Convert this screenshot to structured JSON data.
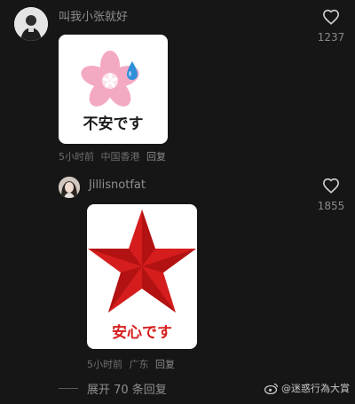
{
  "comments": [
    {
      "username": "叫我小张就好",
      "sticker_caption": "不安です",
      "sticker_icon": "sakura-sweat-icon",
      "time": "5小时前",
      "location": "中国香港",
      "reply_label": "回复",
      "like_count": "1237"
    },
    {
      "username": "Jillisnotfat",
      "sticker_caption": "安心です",
      "sticker_icon": "red-star-icon",
      "time": "5小时前",
      "location": "广东",
      "reply_label": "回复",
      "like_count": "1855"
    }
  ],
  "expand_replies": "展开 70 条回复",
  "watermark": "@迷惑行為大賞",
  "colors": {
    "background": "#161616",
    "star_red": "#d51d1d",
    "sakura_pink": "#f4a9c2"
  }
}
